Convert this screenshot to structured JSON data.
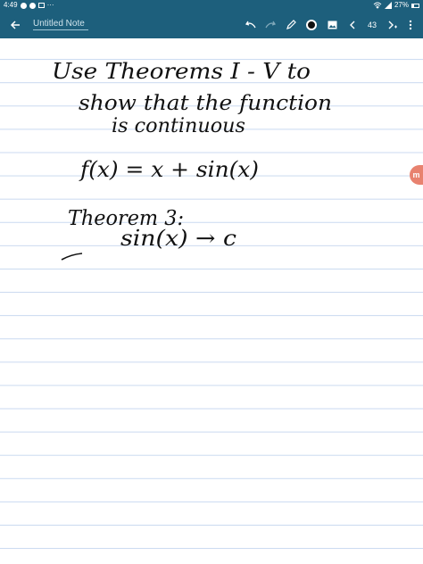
{
  "status_bar": {
    "time": "4:49",
    "overflow": "···",
    "battery_pct": "27%"
  },
  "toolbar": {
    "back_icon": "arrow-left-icon",
    "title": "Untitled Note",
    "undo_icon": "undo-icon",
    "redo_icon": "redo-icon",
    "pen_icon": "pen-icon",
    "color_swatch": "#111111",
    "image_icon": "image-icon",
    "prev_icon": "chevron-left-icon",
    "page_number": "43",
    "next_icon": "chevron-right-icon",
    "more_icon": "more-vertical-icon"
  },
  "note": {
    "lines": [
      "Use Theorems I - V to",
      "show that the function",
      "is continuous",
      "f(x) = x + sin(x)",
      "Theorem 3:",
      "sin(x) → c"
    ]
  },
  "colors": {
    "toolbar": "#1d5f7c",
    "rule_line": "#c9d9f0",
    "ink": "#111111",
    "fab": "#e8826f"
  }
}
